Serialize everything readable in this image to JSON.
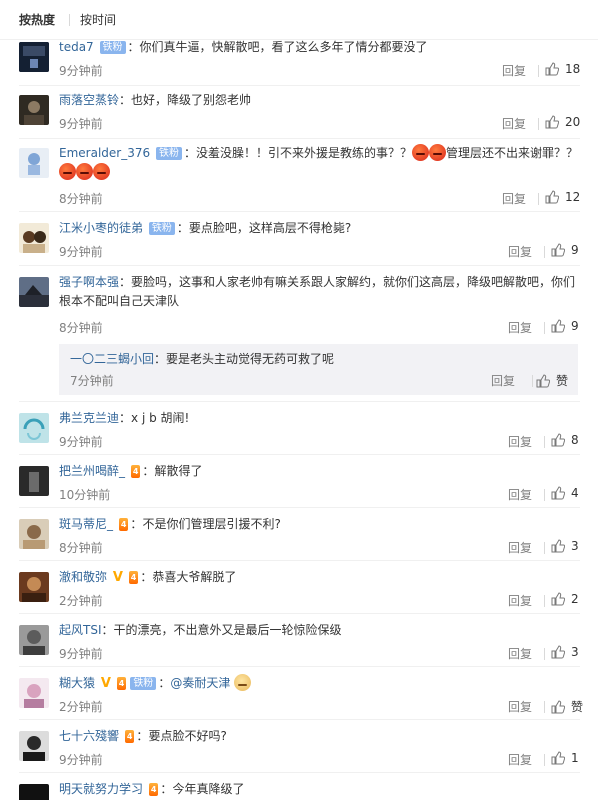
{
  "sort": {
    "hot": "按热度",
    "time": "按时间"
  },
  "comments": [
    {
      "user": "teda7",
      "badge": "铁粉",
      "vip": "",
      "vmark": false,
      "text": "你们真牛逼，快解散吧，看了这么多年了情分都要没了",
      "time": "9分钟前",
      "reply": "回复",
      "likes": "18"
    },
    {
      "user": "雨落空蒸铃",
      "badge": "",
      "vip": "",
      "vmark": false,
      "text": "也好，降级了别怨老帅",
      "time": "9分钟前",
      "reply": "回复",
      "likes": "20"
    },
    {
      "user": "Emeralder_376",
      "badge": "铁粉",
      "vip": "",
      "vmark": false,
      "text_a": "没羞没臊！！引不来外援是教练的事？？",
      "text_b": "管理层还不出来谢罪？？",
      "time": "8分钟前",
      "reply": "回复",
      "likes": "12"
    },
    {
      "user": "江米小枣的徒弟",
      "badge": "铁粉",
      "vip": "",
      "vmark": false,
      "text": "要点脸吧，这样高层不得枪毙?",
      "time": "9分钟前",
      "reply": "回复",
      "likes": "9"
    },
    {
      "user": "强子啊本强",
      "badge": "",
      "vip": "",
      "vmark": false,
      "text": "要脸吗，这事和人家老帅有嘛关系跟人家解约，就你们这高层，降级吧解散吧，你们根本不配叫自己天津队",
      "time": "8分钟前",
      "reply": "回复",
      "likes": "9",
      "sub": {
        "user": "一〇二三蝎小回",
        "text": "要是老头主动觉得无药可救了呢",
        "time": "7分钟前",
        "reply": "回复",
        "likes": "赞"
      }
    },
    {
      "user": "弗兰克兰迪",
      "badge": "",
      "vip": "",
      "vmark": false,
      "text": "x j b 胡闹!",
      "time": "9分钟前",
      "reply": "回复",
      "likes": "8"
    },
    {
      "user": "把兰州喝醉_",
      "badge": "",
      "vip": "4",
      "vmark": false,
      "text": "解散得了",
      "time": "10分钟前",
      "reply": "回复",
      "likes": "4"
    },
    {
      "user": "斑马蒂尼_",
      "badge": "",
      "vip": "4",
      "vmark": false,
      "text": "不是你们管理层引援不利?",
      "time": "8分钟前",
      "reply": "回复",
      "likes": "3"
    },
    {
      "user": "澈和敬弥",
      "badge": "",
      "vip": "4",
      "vmark": true,
      "text": "恭喜大爷解脱了",
      "time": "2分钟前",
      "reply": "回复",
      "likes": "2"
    },
    {
      "user": "起风TSI",
      "badge": "",
      "vip": "",
      "vmark": false,
      "text": "干的漂亮，不出意外又是最后一轮惊险保级",
      "time": "9分钟前",
      "reply": "回复",
      "likes": "3"
    },
    {
      "user": "糊大猿",
      "badge": "铁粉",
      "vip": "4",
      "vmark": true,
      "text": "@奏耐天津",
      "time": "2分钟前",
      "reply": "回复",
      "likes": "赞"
    },
    {
      "user": "七十六殘響",
      "badge": "",
      "vip": "4",
      "vmark": false,
      "text": "要点脸不好吗?",
      "time": "9分钟前",
      "reply": "回复",
      "likes": "1"
    },
    {
      "user": "明天就努力学习",
      "badge": "",
      "vip": "4",
      "vmark": false,
      "text": "今年真降级了",
      "time": "",
      "reply": "",
      "likes": ""
    }
  ]
}
